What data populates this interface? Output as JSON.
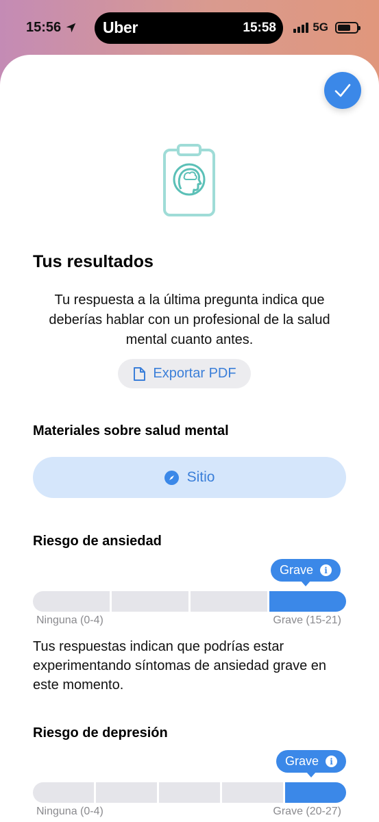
{
  "status_bar": {
    "time": "15:56",
    "island_app": "Uber",
    "island_time": "15:58",
    "network": "5G",
    "battery_level": 0.7
  },
  "results": {
    "title": "Tus resultados",
    "description": "Tu respuesta a la última pregunta indica que deberías hablar con un profesional de la salud mental cuanto antes.",
    "export_label": "Exportar PDF"
  },
  "materials": {
    "title": "Materiales sobre salud mental",
    "site_label": "Sitio"
  },
  "anxiety": {
    "title": "Riesgo de ansiedad",
    "badge": "Grave",
    "levels": 4,
    "active_level": 4,
    "min_label": "Ninguna (0-4)",
    "max_label": "Grave (15-21)",
    "text": "Tus respuestas indican que podrías estar experimentando síntomas de ansiedad grave en este momento."
  },
  "depression": {
    "title": "Riesgo de depresión",
    "badge": "Grave",
    "levels": 5,
    "active_level": 5,
    "min_label": "Ninguna (0-4)",
    "max_label": "Grave (20-27)"
  },
  "colors": {
    "accent": "#3b88e8",
    "link": "#3b7fd9",
    "inactive_segment": "#e5e5ea"
  }
}
